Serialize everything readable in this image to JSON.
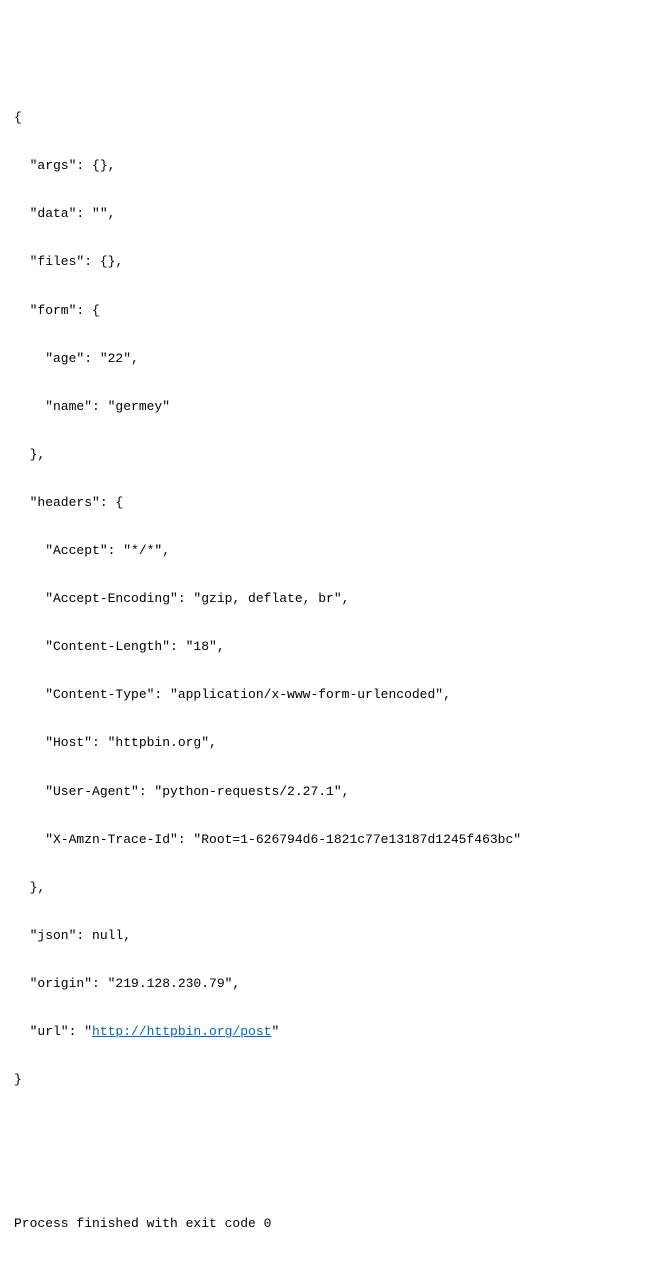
{
  "lines": {
    "l0": "{",
    "l1": "  \"args\": {}, ",
    "l2": "  \"data\": \"\", ",
    "l3": "  \"files\": {}, ",
    "l4": "  \"form\": {",
    "l5": "    \"age\": \"22\", ",
    "l6": "    \"name\": \"germey\"",
    "l7": "  }, ",
    "l8": "  \"headers\": {",
    "l9": "    \"Accept\": \"*/*\", ",
    "l10": "    \"Accept-Encoding\": \"gzip, deflate, br\", ",
    "l11": "    \"Content-Length\": \"18\", ",
    "l12": "    \"Content-Type\": \"application/x-www-form-urlencoded\", ",
    "l13": "    \"Host\": \"httpbin.org\", ",
    "l14": "    \"User-Agent\": \"python-requests/2.27.1\", ",
    "l15": "    \"X-Amzn-Trace-Id\": \"Root=1-626794d6-1821c77e13187d1245f463bc\"",
    "l16": "  }, ",
    "l17": "  \"json\": null, ",
    "l18": "  \"origin\": \"219.128.230.79\", ",
    "l19_pre": "  \"url\": \"",
    "l19_link": "http://httpbin.org/post",
    "l19_post": "\"",
    "l20": "}",
    "footer": "Process finished with exit code 0"
  }
}
